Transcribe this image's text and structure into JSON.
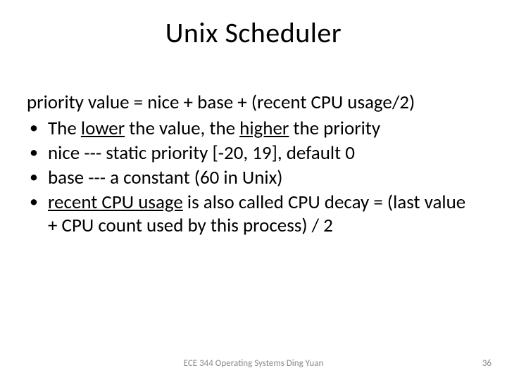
{
  "slide": {
    "title": "Unix Scheduler",
    "formula": "priority value = nice + base + (recent CPU usage/2)",
    "bullets": {
      "b0": {
        "pre": "The ",
        "em1": "lower",
        "mid": " the value, the ",
        "em2": "higher",
        "post": " the priority"
      },
      "b1": "nice --- static priority [-20, 19], default 0",
      "b2": "base --- a constant (60 in Unix)",
      "b3": {
        "u": "recent CPU usage",
        "rest": " is also called CPU decay = (last value + CPU count used by this process) / 2"
      }
    },
    "footer_center": "ECE 344 Operating Systems Ding Yuan",
    "footer_right": "36"
  }
}
